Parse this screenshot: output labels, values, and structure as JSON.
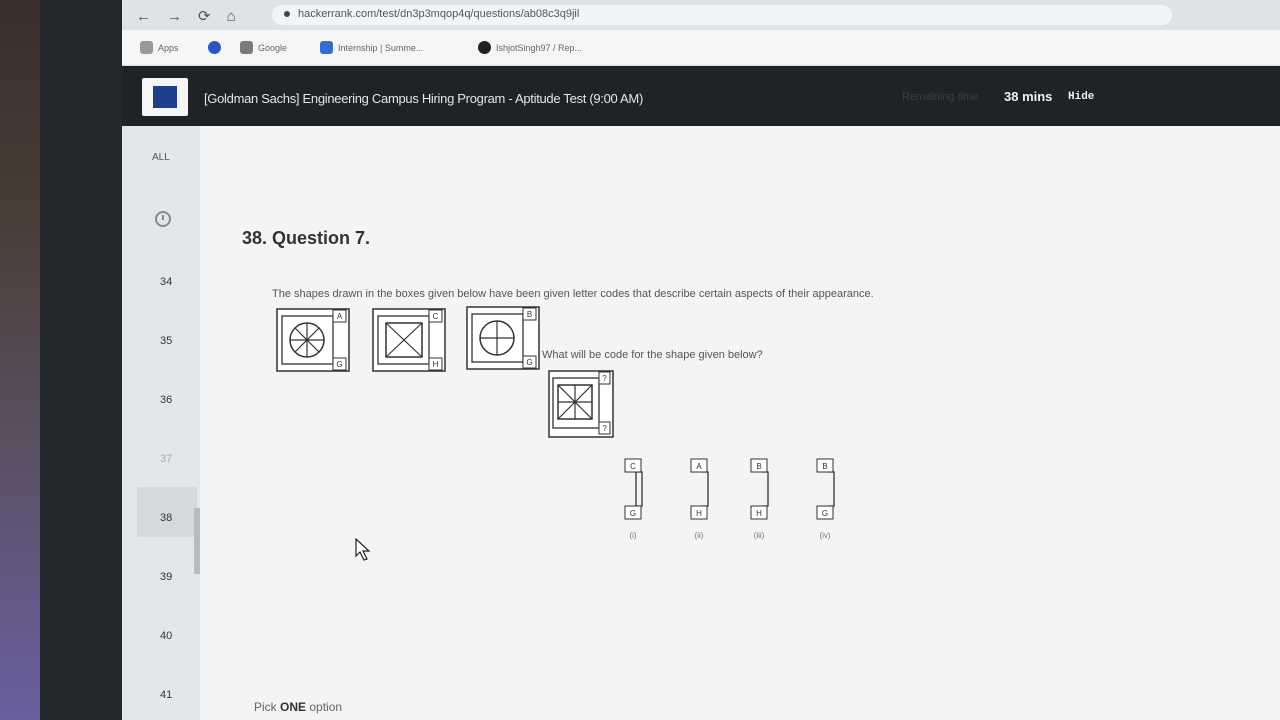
{
  "browser": {
    "url": "hackerrank.com/test/dn3p3mqop4q/questions/ab08c3q9jil",
    "bookmarks": [
      "Apps",
      "Google",
      "Internship | Summe...",
      "IshjotSingh97 / Rep..."
    ]
  },
  "header": {
    "title": "[Goldman Sachs] Engineering Campus Hiring Program - Aptitude Test (9:00 AM)",
    "remaining_label": "Remaining time",
    "time_left": "38 mins",
    "hide_label": "Hide"
  },
  "nav": {
    "all_label": "ALL",
    "questions": [
      "34",
      "35",
      "36",
      "37",
      "38",
      "39",
      "40",
      "41"
    ],
    "current": "38"
  },
  "question": {
    "title": "38. Question 7.",
    "text": "The shapes drawn in the boxes given below have been given letter codes that describe certain aspects of their appearance.",
    "sub_text": "What will be code for the shape given below?",
    "examples": [
      {
        "top": "A",
        "bottom": "G",
        "icon": "circle-spokes-icon"
      },
      {
        "top": "C",
        "bottom": "H",
        "icon": "square-cross-icon"
      },
      {
        "top": "B",
        "bottom": "G",
        "icon": "circle-cross-icon"
      }
    ],
    "target": {
      "top": "?",
      "bottom": "?",
      "icon": "square-star-icon"
    },
    "options": [
      {
        "top": "C",
        "bottom": "G",
        "label": "(i)"
      },
      {
        "top": "A",
        "bottom": "H",
        "label": "(ii)"
      },
      {
        "top": "B",
        "bottom": "H",
        "label": "(iii)"
      },
      {
        "top": "B",
        "bottom": "G",
        "label": "(iv)"
      }
    ],
    "pick_prefix": "Pick",
    "pick_strong": "ONE",
    "pick_suffix": "option"
  }
}
